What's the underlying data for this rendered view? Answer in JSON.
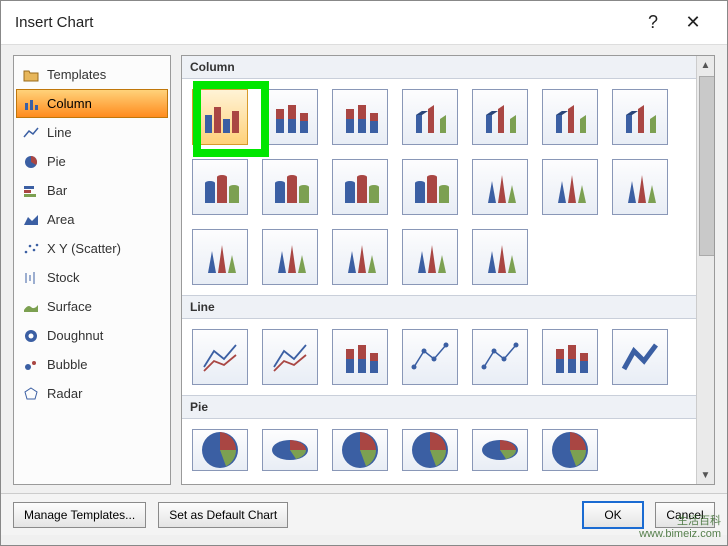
{
  "title": "Insert Chart",
  "help_label": "?",
  "close_label": "✕",
  "sidebar": {
    "items": [
      {
        "label": "Templates",
        "icon": "folder-icon"
      },
      {
        "label": "Column",
        "icon": "column-icon",
        "selected": true
      },
      {
        "label": "Line",
        "icon": "line-icon"
      },
      {
        "label": "Pie",
        "icon": "pie-icon"
      },
      {
        "label": "Bar",
        "icon": "bar-icon"
      },
      {
        "label": "Area",
        "icon": "area-icon"
      },
      {
        "label": "X Y (Scatter)",
        "icon": "scatter-icon"
      },
      {
        "label": "Stock",
        "icon": "stock-icon"
      },
      {
        "label": "Surface",
        "icon": "surface-icon"
      },
      {
        "label": "Doughnut",
        "icon": "doughnut-icon"
      },
      {
        "label": "Bubble",
        "icon": "bubble-icon"
      },
      {
        "label": "Radar",
        "icon": "radar-icon"
      }
    ]
  },
  "sections": {
    "column": "Column",
    "line": "Line",
    "pie": "Pie"
  },
  "column_thumbs": [
    "clustered-column",
    "stacked-column",
    "100pct-stacked-column",
    "3d-clustered-column",
    "3d-stacked-column",
    "3d-100pct-stacked-column",
    "3d-column",
    "clustered-cylinder",
    "stacked-cylinder",
    "100pct-stacked-cylinder",
    "3d-cylinder",
    "clustered-cone",
    "stacked-cone",
    "100pct-stacked-cone",
    "3d-cone",
    "clustered-pyramid",
    "stacked-pyramid",
    "100pct-stacked-pyramid",
    "3d-pyramid"
  ],
  "line_thumbs": [
    "line",
    "stacked-line",
    "100pct-stacked-line",
    "line-markers",
    "stacked-line-markers",
    "100pct-stacked-line-markers",
    "3d-line"
  ],
  "pie_thumbs": [
    "pie",
    "3d-pie",
    "pie-of-pie",
    "exploded-pie",
    "exploded-3d-pie",
    "bar-of-pie"
  ],
  "selected_thumb": "clustered-column",
  "buttons": {
    "manage_templates": "Manage Templates...",
    "set_default": "Set as Default Chart",
    "ok": "OK",
    "cancel": "Cancel"
  },
  "watermark": {
    "line1": "生活百科",
    "line2": "www.bimeiz.com"
  }
}
